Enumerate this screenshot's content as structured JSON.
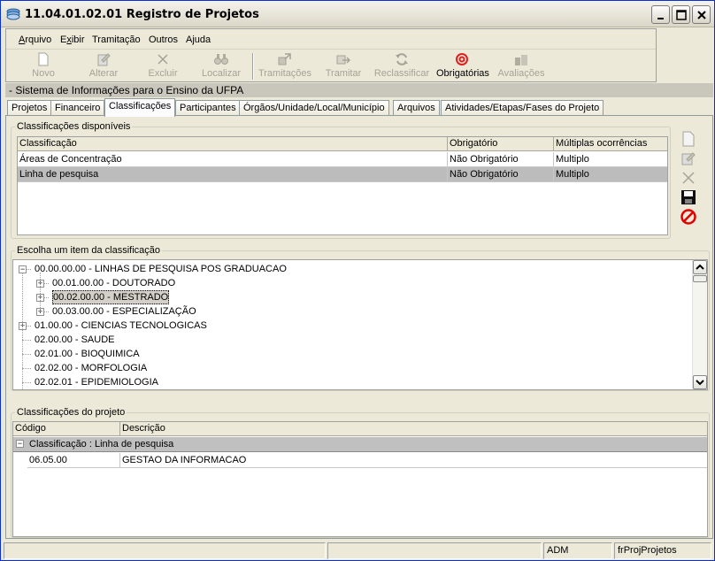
{
  "window": {
    "title": "11.04.01.02.01 Registro de Projetos"
  },
  "menu": {
    "items": [
      "Arquivo",
      "Exibir",
      "Tramitação",
      "Outros",
      "Ajuda"
    ]
  },
  "toolbar": {
    "buttons": [
      {
        "label": "Novo",
        "icon": "new-doc-icon",
        "enabled": false
      },
      {
        "label": "Alterar",
        "icon": "edit-icon",
        "enabled": false
      },
      {
        "label": "Excluir",
        "icon": "delete-icon",
        "enabled": false
      },
      {
        "label": "Localizar",
        "icon": "binoculars-icon",
        "enabled": false
      },
      {
        "label": "Tramitações",
        "icon": "tramitacoes-icon",
        "enabled": false
      },
      {
        "label": "Tramitar",
        "icon": "tramitar-icon",
        "enabled": false
      },
      {
        "label": "Reclassificar",
        "icon": "refresh-icon",
        "enabled": false
      },
      {
        "label": "Obrigatórias",
        "icon": "target-icon",
        "enabled": true
      },
      {
        "label": "Avaliações",
        "icon": "evaluations-icon",
        "enabled": false
      }
    ]
  },
  "system_title": "- Sistema de Informações para o Ensino da UFPA",
  "tabs": [
    "Projetos",
    "Financeiro",
    "Classificações",
    "Participantes",
    "Órgãos/Unidade/Local/Município",
    "Arquivos",
    "Atividades/Etapas/Fases do Projeto"
  ],
  "active_tab": "Classificações",
  "available": {
    "title": "Classificações disponíveis",
    "columns": [
      "Classificação",
      "Obrigatório",
      "Múltiplas ocorrências"
    ],
    "rows": [
      [
        "Áreas de Concentração",
        "Não Obrigatório",
        "Multiplo"
      ],
      [
        "Linha de pesquisa",
        "Não Obrigatório",
        "Multiplo"
      ]
    ],
    "selected_row": 1
  },
  "tree": {
    "title": "Escolha um item da classificação",
    "nodes": [
      {
        "text": "00.00.00.00 - LINHAS DE PESQUISA POS GRADUACAO",
        "level": 0,
        "expander": "−"
      },
      {
        "text": "00.01.00.00 - DOUTORADO",
        "level": 1,
        "expander": "+"
      },
      {
        "text": "00.02.00.00 - MESTRADO",
        "level": 1,
        "expander": "+",
        "selected": true
      },
      {
        "text": "00.03.00.00 - ESPECIALIZAÇÃO",
        "level": 1,
        "expander": "+"
      },
      {
        "text": "01.00.00 - CIENCIAS TECNOLOGICAS",
        "level": 0,
        "expander": "+"
      },
      {
        "text": "02.00.00 - SAUDE",
        "level": 0,
        "expander": ""
      },
      {
        "text": "02.01.00 - BIOQUIMICA",
        "level": 0,
        "expander": ""
      },
      {
        "text": "02.02.00 - MORFOLOGIA",
        "level": 0,
        "expander": ""
      },
      {
        "text": "02.02.01 - EPIDEMIOLOGIA",
        "level": 0,
        "expander": ""
      }
    ]
  },
  "project": {
    "title": "Classificações do projeto",
    "columns": [
      "Código",
      "Descrição"
    ],
    "group_label": "Classificação : Linha de pesquisa",
    "group_expander": "−",
    "rows": [
      [
        "06.05.00",
        "GESTAO DA INFORMACAO"
      ]
    ]
  },
  "status": {
    "user": "ADM",
    "form": "frProjProjetos"
  },
  "colors": {
    "selected_row": "#bcbcbc",
    "window_bg": "#ece9d8",
    "title_border": "#0831d9"
  }
}
